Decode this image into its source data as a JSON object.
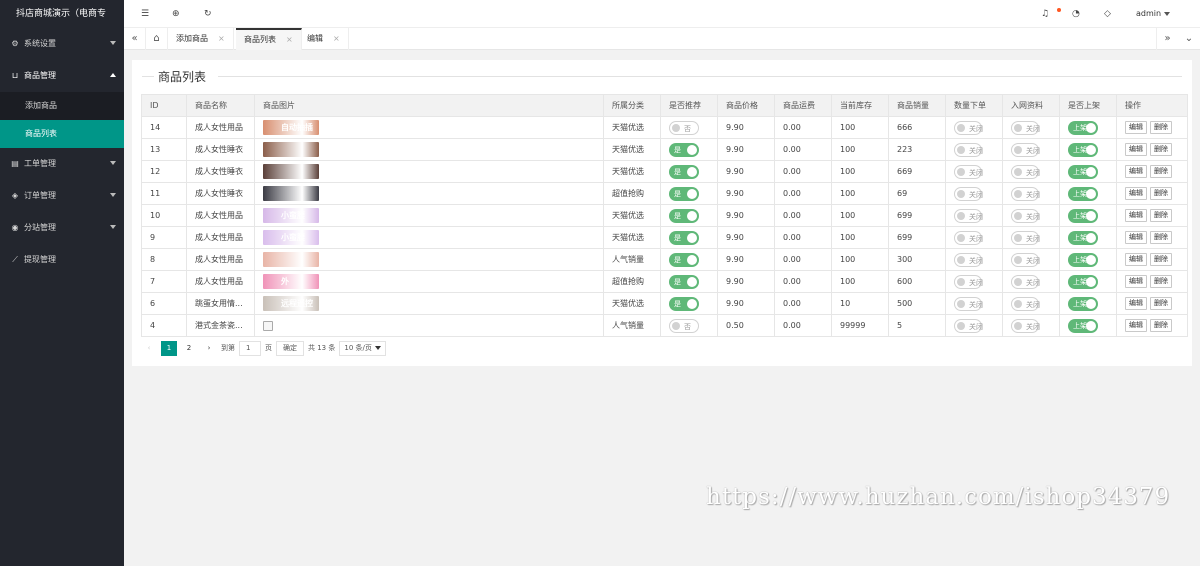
{
  "app": {
    "title": "抖店商城演示（电商专"
  },
  "sidebar": {
    "items": [
      {
        "label": "系统设置",
        "icon": "gear-icon",
        "glyph": "⚙"
      },
      {
        "label": "商品管理",
        "icon": "cart-icon",
        "glyph": "🛒"
      },
      {
        "label": "工单管理",
        "icon": "doc-icon",
        "glyph": "▤"
      },
      {
        "label": "订单管理",
        "icon": "layers-icon",
        "glyph": "◈"
      },
      {
        "label": "分站管理",
        "icon": "globe-icon",
        "glyph": "◉"
      },
      {
        "label": "提现管理",
        "icon": "chart-icon",
        "glyph": "⟋"
      }
    ],
    "sub_items": [
      {
        "label": "添加商品",
        "active": false
      },
      {
        "label": "商品列表",
        "active": true
      }
    ]
  },
  "topbar": {
    "user": "admin"
  },
  "tabs": [
    {
      "label": "添加商品",
      "close": "×"
    },
    {
      "label": "商品列表",
      "close": "×"
    },
    {
      "label": "编辑",
      "close": "×"
    }
  ],
  "page": {
    "title": "商品列表"
  },
  "table": {
    "headers": [
      "ID",
      "商品名称",
      "商品图片",
      "所属分类",
      "是否推荐",
      "商品价格",
      "商品运费",
      "当前库存",
      "商品销量",
      "数量下单",
      "入网资料",
      "是否上架",
      "操作"
    ],
    "rows": [
      {
        "id": "14",
        "name": "成人女性用品",
        "img_text": "自动抽插",
        "img_color": "#d88f70",
        "category": "天猫优选",
        "recommend": false,
        "price": "9.90",
        "shipping": "0.00",
        "stock": "100",
        "sales": "666",
        "qty": false,
        "net": false,
        "onsale": true
      },
      {
        "id": "13",
        "name": "成人女性睡衣",
        "img_text": "",
        "img_color": "#8b5e4a",
        "category": "天猫优选",
        "recommend": true,
        "price": "9.90",
        "shipping": "0.00",
        "stock": "100",
        "sales": "223",
        "qty": false,
        "net": false,
        "onsale": true
      },
      {
        "id": "12",
        "name": "成人女性睡衣",
        "img_text": "",
        "img_color": "#5a3f38",
        "category": "天猫优选",
        "recommend": true,
        "price": "9.90",
        "shipping": "0.00",
        "stock": "100",
        "sales": "669",
        "qty": false,
        "net": false,
        "onsale": true
      },
      {
        "id": "11",
        "name": "成人女性睡衣",
        "img_text": "",
        "img_color": "#3b3b44",
        "category": "超值抢购",
        "recommend": true,
        "price": "9.90",
        "shipping": "0.00",
        "stock": "100",
        "sales": "69",
        "qty": false,
        "net": false,
        "onsale": true
      },
      {
        "id": "10",
        "name": "成人女性用品",
        "img_text": "小蛮腰",
        "img_color": "#d6b8e8",
        "category": "天猫优选",
        "recommend": true,
        "price": "9.90",
        "shipping": "0.00",
        "stock": "100",
        "sales": "699",
        "qty": false,
        "net": false,
        "onsale": true
      },
      {
        "id": "9",
        "name": "成人女性用品",
        "img_text": "小蛮腰",
        "img_color": "#d9bdec",
        "category": "天猫优选",
        "recommend": true,
        "price": "9.90",
        "shipping": "0.00",
        "stock": "100",
        "sales": "699",
        "qty": false,
        "net": false,
        "onsale": true
      },
      {
        "id": "8",
        "name": "成人女性用品",
        "img_text": "",
        "img_color": "#e8b4a6",
        "category": "人气销量",
        "recommend": true,
        "price": "9.90",
        "shipping": "0.00",
        "stock": "100",
        "sales": "300",
        "qty": false,
        "net": false,
        "onsale": true
      },
      {
        "id": "7",
        "name": "成人女性用品",
        "img_text": "外",
        "img_color": "#f093b8",
        "category": "超值抢购",
        "recommend": true,
        "price": "9.90",
        "shipping": "0.00",
        "stock": "100",
        "sales": "600",
        "qty": false,
        "net": false,
        "onsale": true
      },
      {
        "id": "6",
        "name": "跳蛋女用情...",
        "img_text": "远程遥控",
        "img_color": "#c9c0b8",
        "category": "天猫优选",
        "recommend": true,
        "price": "9.90",
        "shipping": "0.00",
        "stock": "10",
        "sales": "500",
        "qty": false,
        "net": false,
        "onsale": true
      },
      {
        "id": "4",
        "name": "港式金茶瓷...",
        "img_text": "",
        "img_color": "",
        "category": "人气销量",
        "recommend": false,
        "price": "0.50",
        "shipping": "0.00",
        "stock": "99999",
        "sales": "5",
        "qty": false,
        "net": false,
        "onsale": true
      }
    ],
    "switch_labels": {
      "yes": "是",
      "no": "否",
      "off": "关闭",
      "onsale": "上架"
    },
    "action_labels": {
      "edit": "编辑",
      "delete": "删除"
    }
  },
  "pagination": {
    "prev": "‹",
    "pages": [
      "1",
      "2"
    ],
    "current": "1",
    "next": "›",
    "goto_label": "到第",
    "goto_value": "1",
    "page_unit": "页",
    "confirm": "确定",
    "total": "共 13 条",
    "per_page": "10 条/页"
  },
  "watermark": "https://www.huzhan.com/ishop34379",
  "colors": {
    "accent": "#009688",
    "switch_on": "#5fb878",
    "sidebar_bg": "#23262e"
  }
}
